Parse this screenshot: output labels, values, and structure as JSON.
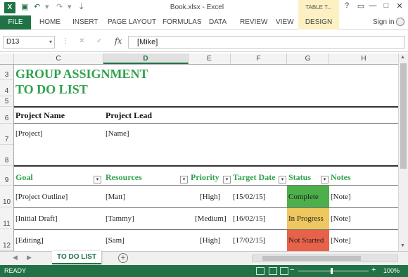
{
  "window": {
    "title": "Book.xlsx - Excel",
    "context_tab_group": "TABLE T...",
    "help": "?",
    "restore": "▭",
    "minimize": "—",
    "maximize": "□",
    "close": "✕"
  },
  "ribbon": {
    "file_label": "FILE",
    "tabs": [
      "HOME",
      "INSERT",
      "PAGE LAYOUT",
      "FORMULAS",
      "DATA",
      "REVIEW",
      "VIEW"
    ],
    "context_tab": "DESIGN",
    "signin": "Sign in"
  },
  "formula_bar": {
    "name_box": "D13",
    "cancel": "✕",
    "enter": "✓",
    "fx": "fx",
    "value": "[Mike]"
  },
  "columns": [
    "C",
    "D",
    "E",
    "F",
    "G",
    "H"
  ],
  "selected_column": "D",
  "rows": [
    "3",
    "4",
    "5",
    "6",
    "7",
    "8",
    "9",
    "10",
    "11",
    "12"
  ],
  "sheet": {
    "title_line1": "GROUP ASSIGNMENT",
    "title_line2": "TO DO LIST",
    "project_name_label": "Project Name",
    "project_lead_label": "Project Lead",
    "project_name_value": "[Project]",
    "project_lead_value": "[Name]",
    "table_headers": {
      "goal": "Goal",
      "resources": "Resources",
      "priority": "Priority",
      "target_date": "Target Date",
      "status": "Status",
      "notes": "Notes"
    },
    "filter_glyph": "▾",
    "tasks": [
      {
        "goal": "[Project Outline]",
        "resources": "[Matt]",
        "priority": "[High]",
        "target_date": "[15/02/15]",
        "status": "Complete",
        "notes": "[Note]"
      },
      {
        "goal": "[Initial Draft]",
        "resources": "[Tammy]",
        "priority": "[Medium]",
        "target_date": "[16/02/15]",
        "status": "In Progress",
        "notes": "[Note]"
      },
      {
        "goal": "[Editing]",
        "resources": "[Sam]",
        "priority": "[High]",
        "target_date": "[17/02/15]",
        "status": "Not Started",
        "notes": "[Note]"
      }
    ],
    "status_colors": {
      "Complete": "#4daf4a",
      "In Progress": "#eec75e",
      "Not Started": "#e8624a"
    }
  },
  "sheet_tabs": {
    "active": "TO DO LIST",
    "add": "+"
  },
  "status_bar": {
    "ready": "READY",
    "zoom_minus": "−",
    "zoom_plus": "+",
    "zoom": "100%"
  },
  "colors": {
    "accent": "#217346",
    "title_green": "#2ea24a"
  }
}
